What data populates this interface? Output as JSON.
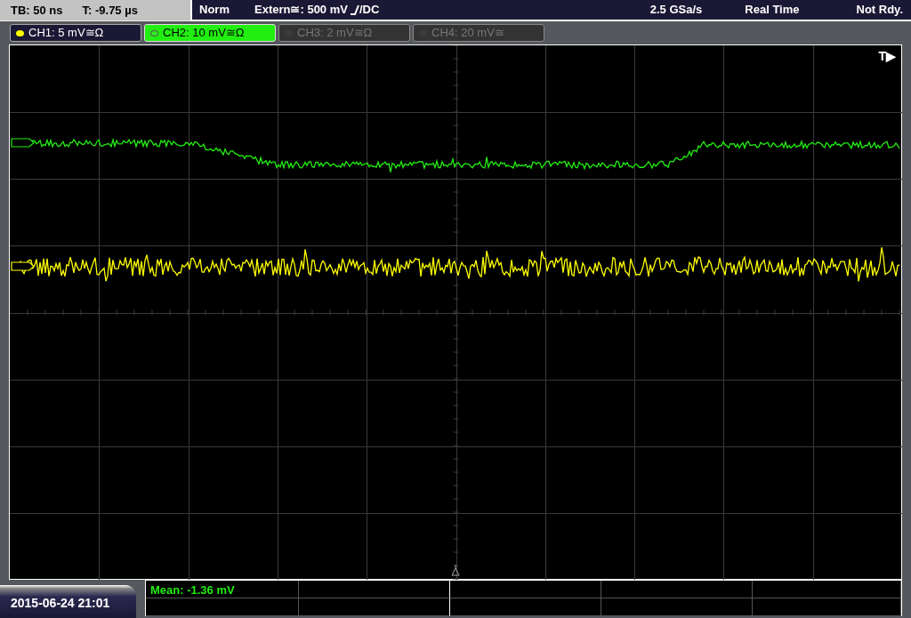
{
  "status_bar": {
    "timebase": "TB: 50 ns",
    "trigger_time": "T: -9.75 µs",
    "mode": "Norm",
    "trigger_source": "Extern≅: 500 mV",
    "coupling": "/DC",
    "sample_rate": "2.5 GSa/s",
    "acquisition": "Real Time",
    "state": "Not Rdy."
  },
  "channels": [
    {
      "label": "CH1: 5 mV≅Ω",
      "color": "#ffff00",
      "selected": false,
      "on": true
    },
    {
      "label": "CH2: 10 mV≅Ω",
      "color": "#33ee22",
      "selected": true,
      "on": true
    },
    {
      "label": "CH3: 2 mV≅Ω",
      "color": "#3c3c3c",
      "selected": false,
      "on": false
    },
    {
      "label": "CH4: 20 mV≅",
      "color": "#3c3c3c",
      "selected": false,
      "on": false
    }
  ],
  "display": {
    "trigger_label": "T▶"
  },
  "measurements": {
    "rows": [
      [
        "Mean: -1.36 mV"
      ]
    ]
  },
  "datetime": "2015-06-24 21:01"
}
